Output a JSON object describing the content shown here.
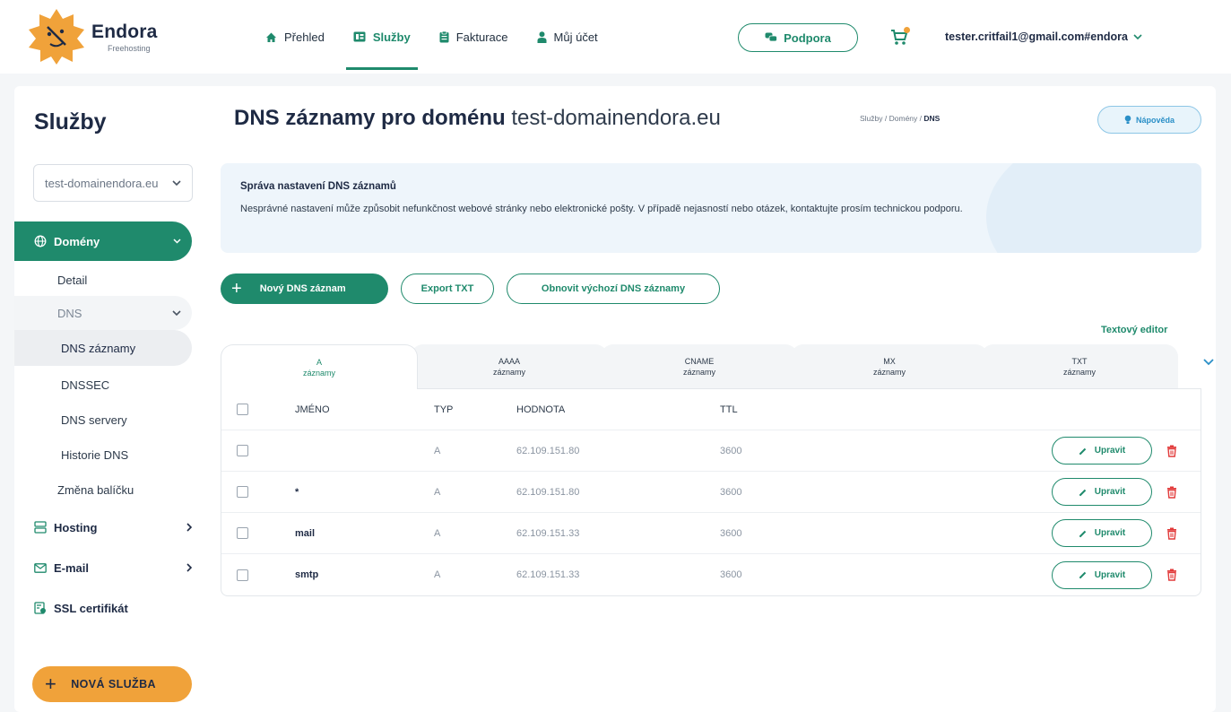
{
  "header": {
    "logo_name": "Endora",
    "logo_sub": "Freehosting",
    "nav": [
      {
        "label": "Přehled",
        "icon": "home-icon"
      },
      {
        "label": "Služby",
        "icon": "services-icon"
      },
      {
        "label": "Fakturace",
        "icon": "invoice-icon"
      },
      {
        "label": "Můj účet",
        "icon": "user-icon"
      }
    ],
    "support_label": "Podpora",
    "user_email": "tester.critfail1@gmail.com#endora"
  },
  "sidebar": {
    "title": "Služby",
    "domain_select": "test-domainendora.eu",
    "domeny_label": "Domény",
    "detail_label": "Detail",
    "dns_label": "DNS",
    "dns_items": [
      "DNS záznamy",
      "DNSSEC",
      "DNS servery",
      "Historie DNS"
    ],
    "package_change": "Změna balíčku",
    "hosting_label": "Hosting",
    "email_label": "E-mail",
    "ssl_label": "SSL certifikát",
    "new_service_label": "NOVÁ SLUŽBA"
  },
  "page": {
    "title_bold": "DNS záznamy pro doménu",
    "title_domain": "test-domainendora.eu",
    "breadcrumb": [
      "Služby",
      "Domény",
      "DNS"
    ],
    "help_label": "Nápověda",
    "info_title": "Správa nastavení DNS záznamů",
    "info_text": "Nesprávné nastavení může způsobit nefunkčnost webové stránky nebo elektronické pošty. V případě nejasností nebo otázek, kontaktujte prosím technickou podporu.",
    "btn_new": "Nový DNS záznam",
    "btn_export": "Export TXT",
    "btn_restore": "Obnovit výchozí DNS záznamy",
    "text_editor": "Textový editor"
  },
  "tabs": [
    {
      "type": "A",
      "sub": "záznamy"
    },
    {
      "type": "AAAA",
      "sub": "záznamy"
    },
    {
      "type": "CNAME",
      "sub": "záznamy"
    },
    {
      "type": "MX",
      "sub": "záznamy"
    },
    {
      "type": "TXT",
      "sub": "záznamy"
    }
  ],
  "table": {
    "headers": [
      "JMÉNO",
      "TYP",
      "HODNOTA",
      "TTL"
    ],
    "edit_label": "Upravit",
    "rows": [
      {
        "name": "",
        "type": "A",
        "value": "62.109.151.80",
        "ttl": "3600"
      },
      {
        "name": "*",
        "type": "A",
        "value": "62.109.151.80",
        "ttl": "3600"
      },
      {
        "name": "mail",
        "type": "A",
        "value": "62.109.151.33",
        "ttl": "3600"
      },
      {
        "name": "smtp",
        "type": "A",
        "value": "62.109.151.33",
        "ttl": "3600"
      }
    ]
  },
  "colors": {
    "accent": "#1f8a6c",
    "orange": "#f0a23a",
    "danger": "#e23b3b",
    "info": "#2a8fc7"
  }
}
